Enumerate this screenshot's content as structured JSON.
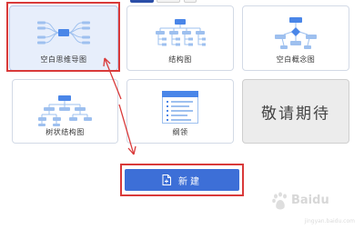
{
  "templates": [
    {
      "id": "mindmap",
      "label": "空白思维导图",
      "icon": "mindmap-icon",
      "active": true
    },
    {
      "id": "structure",
      "label": "结构图",
      "icon": "org-chart-icon",
      "active": false
    },
    {
      "id": "concept",
      "label": "空白概念图",
      "icon": "concept-map-icon",
      "active": false
    },
    {
      "id": "tree",
      "label": "树状结构图",
      "icon": "tree-chart-icon",
      "active": false
    },
    {
      "id": "outline",
      "label": "纲领",
      "icon": "outline-icon",
      "active": false
    }
  ],
  "placeholder_card": {
    "label": "敬请期待"
  },
  "new_button": {
    "label": "新建",
    "icon": "new-file-icon"
  },
  "watermark": {
    "text": "Baidu",
    "sub": "jingyan.baidu.com"
  },
  "colors": {
    "accent": "#3d6fd7",
    "highlight": "#d93a3a",
    "active_card_bg": "#e7eefb",
    "diagram_blue": "#4a86e8",
    "diagram_light": "#9ec0ef"
  }
}
